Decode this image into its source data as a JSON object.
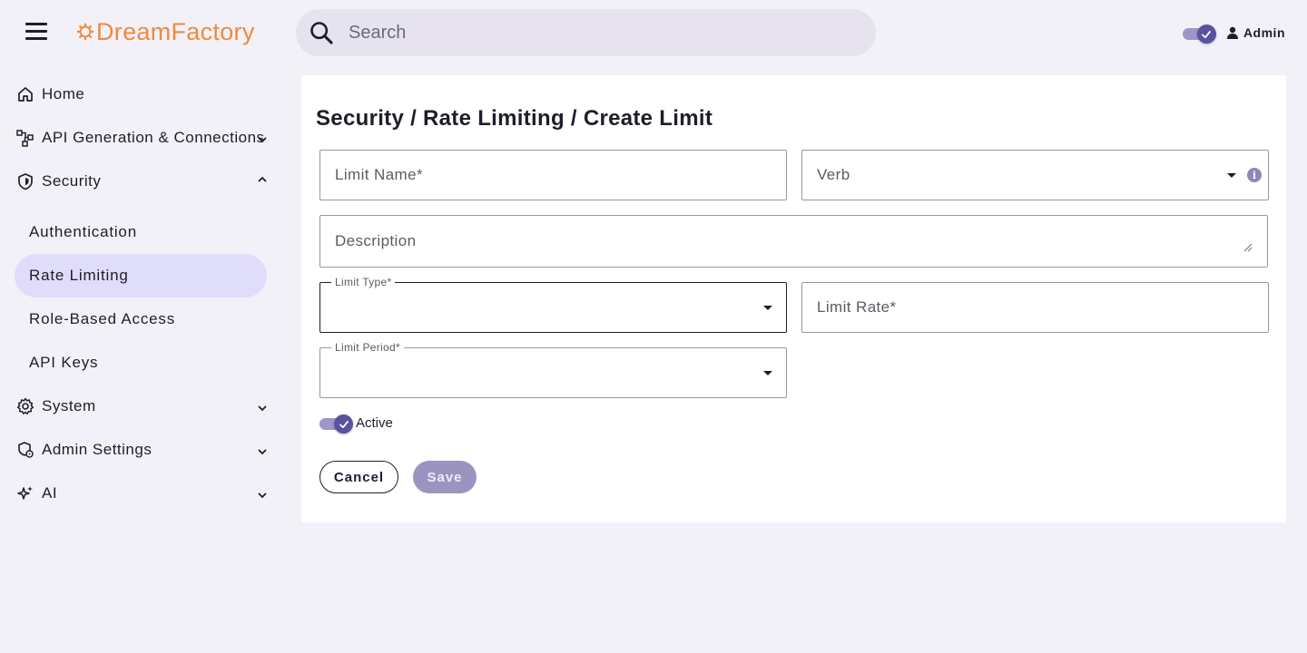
{
  "brand": {
    "name": "DreamFactory",
    "color": "#f08a3c",
    "icon": "gear-icon"
  },
  "search": {
    "placeholder": "Search"
  },
  "user": {
    "name": "Admin",
    "theme_toggle_on": true
  },
  "sidebar": {
    "items": [
      {
        "label": "Home",
        "icon": "home-icon"
      },
      {
        "label": "API Generation & Connections",
        "icon": "connections-icon",
        "expanded": false
      },
      {
        "label": "Security",
        "icon": "shield-icon",
        "expanded": true
      },
      {
        "label": "System",
        "icon": "gear-icon",
        "expanded": false
      },
      {
        "label": "Admin Settings",
        "icon": "admin-settings-icon",
        "expanded": false
      },
      {
        "label": "AI",
        "icon": "sparkle-icon",
        "expanded": false
      }
    ],
    "security_sub": [
      {
        "label": "Authentication"
      },
      {
        "label": "Rate Limiting",
        "active": true
      },
      {
        "label": "Role-Based Access"
      },
      {
        "label": "API Keys"
      }
    ]
  },
  "page": {
    "title": "Security / Rate Limiting / Create Limit"
  },
  "form": {
    "limit_name": {
      "placeholder": "Limit Name*",
      "value": ""
    },
    "verb": {
      "placeholder": "Verb",
      "value": ""
    },
    "description": {
      "placeholder": "Description",
      "value": ""
    },
    "limit_type": {
      "label": "Limit Type*",
      "value": ""
    },
    "limit_rate": {
      "placeholder": "Limit Rate*",
      "value": ""
    },
    "limit_period": {
      "label": "Limit Period*",
      "value": ""
    },
    "active": {
      "label": "Active",
      "checked": true
    },
    "cancel_label": "Cancel",
    "save_label": "Save"
  },
  "colors": {
    "accent": "#5a529f",
    "active_nav": "#e0ddfb",
    "save_disabled": "#9995c0"
  }
}
